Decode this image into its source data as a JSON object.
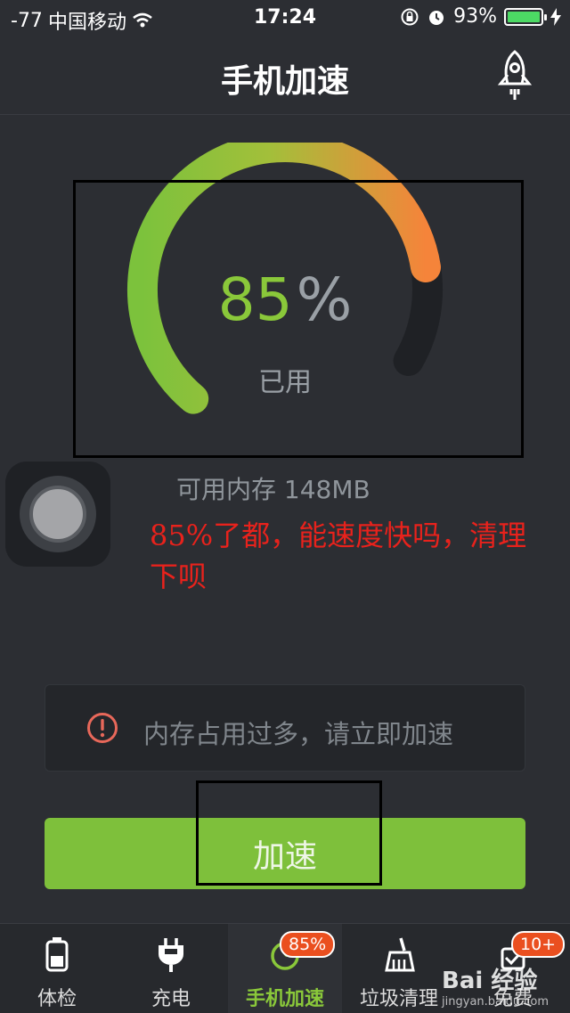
{
  "status_bar": {
    "signal": "-77",
    "carrier": "中国移动",
    "time": "17:24",
    "battery": "93%"
  },
  "header": {
    "title": "手机加速"
  },
  "gauge": {
    "percent": "85",
    "percent_sign": "%",
    "label": "已用",
    "fraction_used": 0.85
  },
  "memory": {
    "available_label": "可用内存 148MB"
  },
  "annotation": {
    "text": "85%了都，能速度快吗，清理下呗"
  },
  "warning": {
    "text": "内存占用过多，请立即加速"
  },
  "action": {
    "button_label": "加速"
  },
  "tabs": [
    {
      "label": "体检"
    },
    {
      "label": "充电"
    },
    {
      "label": "手机加速",
      "badge": "85%"
    },
    {
      "label": "垃圾清理"
    },
    {
      "label": "免费",
      "badge": "10+"
    }
  ],
  "watermark": {
    "brand": "Bai 经验",
    "url": "jingyan.baidu.com"
  },
  "colors": {
    "accent_green": "#7ec03b",
    "gauge_orange": "#f0883a",
    "background": "#2c2e33",
    "annotation_red": "#e8221c",
    "badge_orange": "#ea4f1f"
  }
}
